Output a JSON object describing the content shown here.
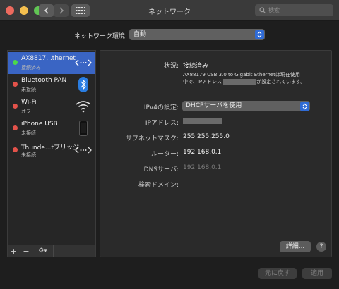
{
  "window": {
    "title": "ネットワーク",
    "search_placeholder": "検索"
  },
  "location": {
    "label": "ネットワーク環境:",
    "value": "自動"
  },
  "services": [
    {
      "name": "AX8817...thernet",
      "status": "接続済み",
      "state": "connected",
      "icon": "ethernet-icon"
    },
    {
      "name": "Bluetooth PAN",
      "status": "未接続",
      "state": "disconnected",
      "icon": "bluetooth-icon"
    },
    {
      "name": "Wi-Fi",
      "status": "オフ",
      "state": "off",
      "icon": "wifi-icon"
    },
    {
      "name": "iPhone USB",
      "status": "未接続",
      "state": "disconnected",
      "icon": "iphone-icon"
    },
    {
      "name": "Thunde...tブリッジ",
      "status": "未接続",
      "state": "disconnected",
      "icon": "thunderbolt-bridge-icon"
    }
  ],
  "sidebar_footer": {
    "add": "+",
    "remove": "−",
    "actions": "⚙▾"
  },
  "detail": {
    "status_label": "状況:",
    "status_value": "接続済み",
    "description_line1": "AX88179 USB 3.0 to Gigabit Ethernetは現在使用",
    "description_line2_a": "中で、IPアドレス",
    "description_line2_b": "が設定されています。",
    "ipv4_label": "IPv4の設定:",
    "ipv4_value": "DHCPサーバを使用",
    "ip_label": "IPアドレス:",
    "subnet_label": "サブネットマスク:",
    "subnet_value": "255.255.255.0",
    "router_label": "ルーター:",
    "router_value": "192.168.0.1",
    "dns_label": "DNSサーバ:",
    "dns_value": "192.168.0.1",
    "search_domain_label": "検索ドメイン:",
    "details_button": "詳細...",
    "help_button": "?"
  },
  "bottom": {
    "revert": "元に戻す",
    "apply": "適用"
  },
  "colors": {
    "accent": "#3a65c4",
    "connected": "#4bd84b",
    "disconnected": "#e3524a",
    "select_arrow": "#2f6bd6",
    "bluetooth": "#2a7de1"
  }
}
